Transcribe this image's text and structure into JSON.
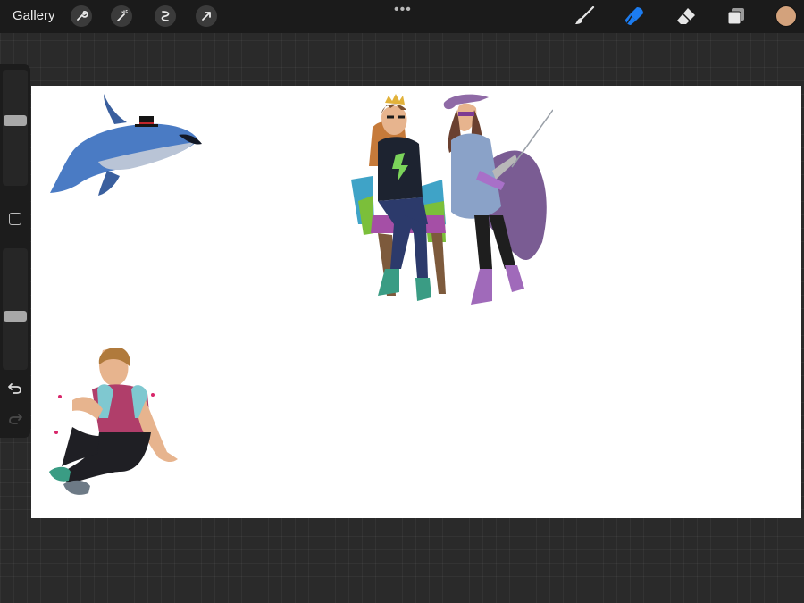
{
  "toolbar": {
    "gallery_label": "Gallery",
    "left_tools": [
      "wrench-icon",
      "magic-wand-icon",
      "selection-icon",
      "transform-arrow-icon"
    ],
    "menu_glyph": "•••",
    "right_tools": [
      "brush-icon",
      "smudge-icon",
      "eraser-icon",
      "layers-icon"
    ],
    "active_tool": "smudge",
    "active_color": "#d3a27c",
    "accent_color": "#1c7cf0"
  },
  "sidebar": {
    "controls": [
      "brush-size-slider",
      "modify-button",
      "opacity-slider",
      "undo-icon",
      "redo-icon"
    ]
  },
  "canvas": {
    "background": "#ffffff",
    "artworks": [
      "flying-whale-with-top-hat",
      "boy-on-throne-and-masked-swordswoman",
      "sitting-boy-with-backpack"
    ]
  }
}
